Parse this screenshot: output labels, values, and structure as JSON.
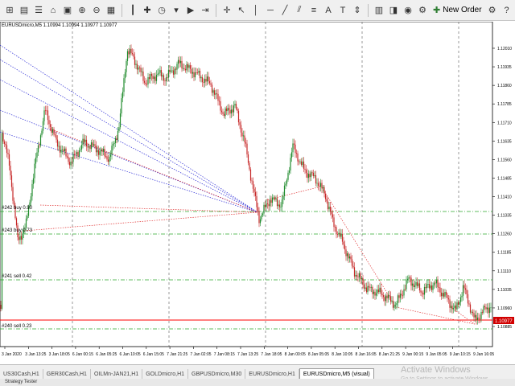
{
  "toolbar": {
    "new_order_label": "New Order",
    "icons": [
      "new-chart-icon",
      "profiles-icon",
      "market-watch-icon",
      "navigator-icon",
      "terminal-icon",
      "zoom-in-icon",
      "zoom-out-icon",
      "tile-windows-icon",
      "bar-chart-icon",
      "candlestick-icon",
      "line-chart-icon",
      "indicators-icon",
      "periods-icon",
      "templates-icon",
      "autoscroll-icon",
      "chart-shift-icon",
      "crosshair-icon",
      "vertical-line-icon",
      "horizontal-line-icon",
      "trendline-icon",
      "channel-icon",
      "fibonacci-icon",
      "text-icon",
      "label-icon",
      "arrows-icon",
      "history-center-icon",
      "data-window-icon",
      "strategy-tester-icon",
      "expert-advisors-icon",
      "alert-icon",
      "new-order-icon",
      "settings-icon",
      "help-icon"
    ]
  },
  "chart": {
    "symbol_info": "EURUSDmicro,M5  1.10994 1.10994 1.10977 1.10977",
    "current_price": "1.10977",
    "price_labels": [
      "1.12010",
      "1.11935",
      "1.11860",
      "1.11785",
      "1.11710",
      "1.11635",
      "1.11560",
      "1.11485",
      "1.11410",
      "1.11335",
      "1.11260",
      "1.11185",
      "1.11110",
      "1.11035",
      "1.10960",
      "1.10885"
    ],
    "time_labels": [
      "3 Jan 2020",
      "3 Jan 13:25",
      "3 Jan 18:05",
      "6 Jan 00:15",
      "6 Jan 05:25",
      "6 Jan 10:05",
      "6 Jan 15:05",
      "7 Jan 21:25",
      "7 Jan 02:05",
      "7 Jan 08:15",
      "7 Jan 13:25",
      "7 Jan 18:05",
      "8 Jan 00:05",
      "8 Jan 05:05",
      "8 Jan 10:05",
      "8 Jan 16:05",
      "8 Jan 21:25",
      "9 Jan 00:15",
      "9 Jan 05:05",
      "9 Jan 10:15",
      "9 Jan 16:05"
    ],
    "order_labels": [
      "#242 buy 0.90",
      "#243 buy 0.73",
      "#241 sell 0.42",
      "#240 sell 0.23"
    ]
  },
  "tabs": [
    {
      "label": "US30Cash,H1"
    },
    {
      "label": "GER30Cash,H1"
    },
    {
      "label": "OILMn-JAN21,H1"
    },
    {
      "label": "GOLDmicro,H1"
    },
    {
      "label": "GBPUSDmicro,M30"
    },
    {
      "label": "EURUSDmicro,H1"
    },
    {
      "label": "EURUSDmicro,M5 (visual)"
    }
  ],
  "status": {
    "text": "Strategy Tester"
  },
  "watermark": {
    "title": "Activate Windows",
    "subtitle": "Go to Settings to activate Windows."
  },
  "colors": {
    "bull": "#1f8a2c",
    "bear": "#c62828",
    "grid": "#bfbfbf",
    "sell_level": "#ff0000",
    "dotted_blue": "#2b2bd6",
    "dotted_red": "#e03030",
    "order_line": "#2ea82e"
  }
}
